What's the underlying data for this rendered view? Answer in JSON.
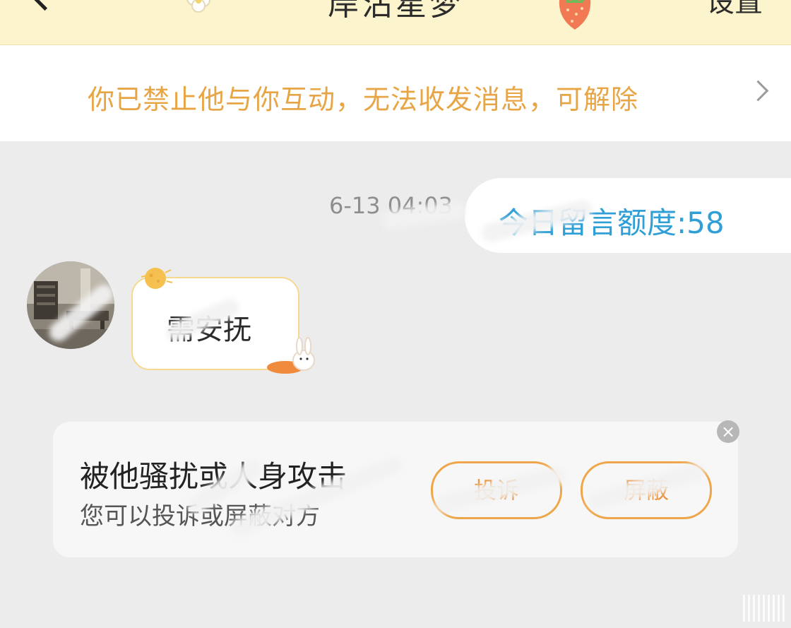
{
  "header": {
    "title": "岸沾星梦",
    "settings_label": "设置",
    "background": "#fcf4cc"
  },
  "notice": {
    "text": "你已禁止他与你互动，无法收发消息，可解除",
    "color": "#e8a546"
  },
  "chat": {
    "timestamp": "6-13 04:03",
    "quota": "今日留言额度:58",
    "quota_color": "#2f9fd6",
    "incoming_message": "需安抚"
  },
  "harassment_card": {
    "title": "被他骚扰或人身攻击",
    "subtitle": "您可以投诉或屏蔽对方",
    "report_button": "投诉",
    "block_button": "屏蔽",
    "close_label": "×",
    "accent": "#efa64a"
  }
}
